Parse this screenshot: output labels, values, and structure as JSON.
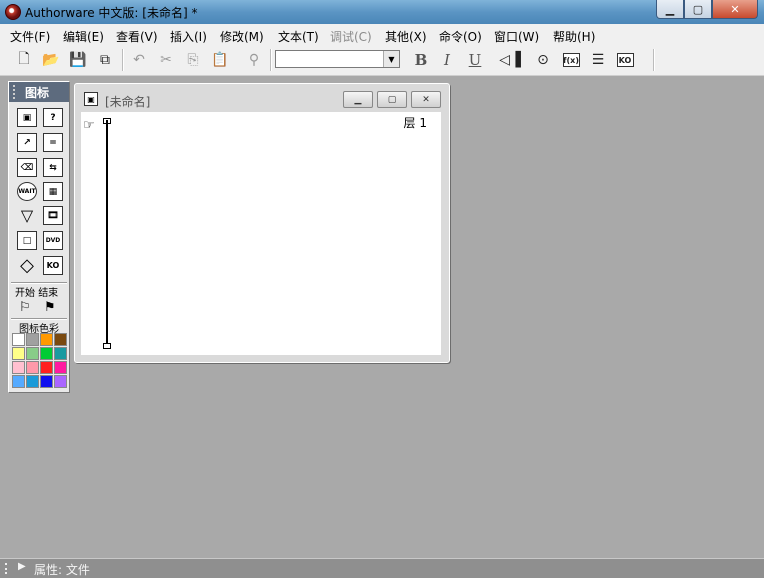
{
  "window": {
    "title": "Authorware 中文版: [未命名] *",
    "controls": {
      "minimize": "▁",
      "maximize": "▢",
      "close": "✕"
    }
  },
  "menu": [
    {
      "label": "文件(F)",
      "enabled": true
    },
    {
      "label": "编辑(E)",
      "enabled": true
    },
    {
      "label": "查看(V)",
      "enabled": true
    },
    {
      "label": "插入(I)",
      "enabled": true
    },
    {
      "label": "修改(M)",
      "enabled": true
    },
    {
      "label": "文本(T)",
      "enabled": true
    },
    {
      "label": "调试(C)",
      "enabled": false
    },
    {
      "label": "其他(X)",
      "enabled": true
    },
    {
      "label": "命令(O)",
      "enabled": true
    },
    {
      "label": "窗口(W)",
      "enabled": true
    },
    {
      "label": "帮助(H)",
      "enabled": true
    }
  ],
  "toolbar": {
    "font_select_value": "",
    "bold": "B",
    "italic": "I",
    "underline": "U",
    "fx": "f(x)",
    "ko": "KO"
  },
  "palette": {
    "title": "图标",
    "icons": [
      {
        "name": "display-icon",
        "glyph": "▣"
      },
      {
        "name": "interaction-icon",
        "glyph": "?"
      },
      {
        "name": "motion-icon",
        "glyph": "↗"
      },
      {
        "name": "calculation-icon",
        "glyph": "="
      },
      {
        "name": "erase-icon",
        "glyph": "⌫"
      },
      {
        "name": "navigate-icon",
        "glyph": "⇆"
      },
      {
        "name": "wait-icon",
        "glyph": "WAIT"
      },
      {
        "name": "framework-icon",
        "glyph": "▦"
      },
      {
        "name": "decision-icon",
        "glyph": "▽"
      },
      {
        "name": "digital-movie-icon",
        "glyph": "🎞"
      },
      {
        "name": "map-icon",
        "glyph": "□"
      },
      {
        "name": "dvd-icon",
        "glyph": "DVD"
      },
      {
        "name": "sound-icon",
        "glyph": "◇"
      },
      {
        "name": "knowledge-object-icon",
        "glyph": "KO"
      }
    ],
    "start_label": "开始",
    "end_label": "结束",
    "color_section_label": "图标色彩",
    "colors": [
      "#ffffff",
      "#a0a0a0",
      "#ff9900",
      "#7a4a10",
      "#ffff88",
      "#88cc88",
      "#00cc33",
      "#1a9aa0",
      "#ffc0d0",
      "#ff99aa",
      "#ff2020",
      "#ff1aa0",
      "#55aaff",
      "#1a9ad8",
      "#1010ee",
      "#aa66ff"
    ]
  },
  "flowline_window": {
    "title": "[未命名]",
    "layer_label": "层 1"
  },
  "status": {
    "text": "属性: 文件"
  }
}
